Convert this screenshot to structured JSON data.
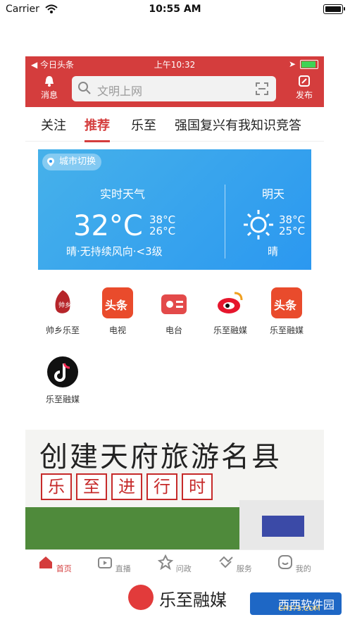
{
  "ios": {
    "carrier": "Carrier",
    "time": "10:55 AM"
  },
  "app": {
    "inner_status": {
      "left_text": "◀ 今日头条",
      "time": "上午10:32"
    },
    "header": {
      "left_label": "消息",
      "search_placeholder": "文明上网",
      "right_label": "发布"
    },
    "tabs": [
      "关注",
      "推荐",
      "乐至",
      "强国复兴有我知识竞答"
    ],
    "weather": {
      "city_chip": "城市切换",
      "today_label": "实时天气",
      "today_temp": "32°C",
      "today_high": "38°C",
      "today_low": "26°C",
      "today_desc": "晴·无持续风向·<3级",
      "tomorrow_label": "明天",
      "tomorrow_high": "38°C",
      "tomorrow_low": "25°C",
      "tomorrow_desc": "晴"
    },
    "grid": [
      {
        "label": "帅乡乐至"
      },
      {
        "label": "电视",
        "icon_text": "头条"
      },
      {
        "label": "电台"
      },
      {
        "label": "乐至融媒"
      },
      {
        "label": "乐至融媒",
        "icon_text": "头条"
      },
      {
        "label": "乐至融媒"
      }
    ],
    "banner": {
      "title": "创建天府旅游名县",
      "subtitle": [
        "乐",
        "至",
        "进",
        "行",
        "时"
      ]
    },
    "bottom_nav": [
      "首页",
      "直播",
      "问政",
      "服务",
      "我的"
    ]
  },
  "footer": {
    "brand": "乐至融媒",
    "watermark": "西西软件园",
    "watermark_url": "CR173.COM"
  },
  "colors": {
    "brand_red": "#d43d3d",
    "weather_blue": "#2b98f0"
  }
}
